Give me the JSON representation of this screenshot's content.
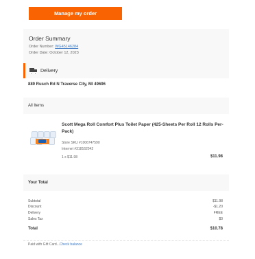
{
  "header": {
    "manage_button": "Manage my order"
  },
  "summary": {
    "title": "Order Summary",
    "order_number_label": "Order Number: ",
    "order_number": "WG45146284",
    "order_date": "Order Date: October 12, 2023"
  },
  "delivery": {
    "label": "Delivery",
    "address": "889 Rusch Rd N Traverse City, MI 49696"
  },
  "items": {
    "heading": "All Items",
    "list": [
      {
        "title": "Scott Mega Roll Comfort Plus Toilet Paper (425-Sheets Per Roll 12 Rolls Per-Pack)",
        "store_sku": "Store SKU #1006747590",
        "internet": "Internet #318162042",
        "qty_price": "1 x $11.98",
        "price": "$11.98"
      }
    ]
  },
  "totals": {
    "heading": "Your Total",
    "subtotal_label": "Subtotal",
    "subtotal": "$11.98",
    "discount_label": "Discount",
    "discount": "-$1.20",
    "delivery_label": "Delivery",
    "delivery": "FREE",
    "tax_label": "Sales Tax",
    "tax": "$0",
    "total_label": "Total",
    "total": "$10.78"
  },
  "gift": {
    "text": "Paid with Gift Card...",
    "link": "Check balance"
  },
  "colors": {
    "accent": "#f96302",
    "link": "#3e7ac4",
    "panel": "#f8f8f8"
  }
}
